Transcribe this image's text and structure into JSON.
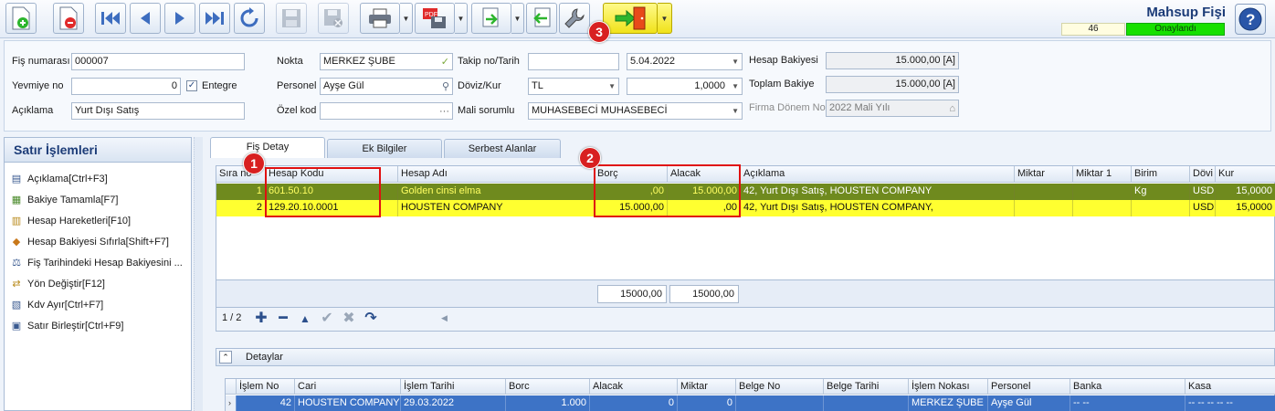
{
  "window": {
    "title": "Mahsup Fişi",
    "doc_count": "46",
    "status": "Onaylandı"
  },
  "toolbar": {
    "icons": [
      "new-icon",
      "delete-icon",
      "first-icon",
      "prev-icon",
      "next-icon",
      "last-icon",
      "refresh-icon",
      "save-icon",
      "cancel-save-icon",
      "print-icon",
      "pdf-icon",
      "export-icon",
      "import-icon",
      "settings-icon",
      "exit-icon"
    ],
    "markers": [
      "1",
      "2",
      "3"
    ]
  },
  "header": {
    "fis_no_label": "Fiş numarası",
    "fis_no_value": "000007",
    "yevmiye_label": "Yevmiye no",
    "yevmiye_value": "0",
    "entegre_label": "Entegre",
    "aciklama_label": "Açıklama",
    "aciklama_value": "Yurt Dışı Satış",
    "nokta_label": "Nokta",
    "nokta_value": "MERKEZ ŞUBE",
    "personel_label": "Personel",
    "personel_value": "Ayşe Gül",
    "ozel_kod_label": "Özel kod",
    "ozel_kod_value": "",
    "takip_label": "Takip no/Tarih",
    "takip_value": "",
    "tarih_value": "5.04.2022",
    "doviz_label": "Döviz/Kur",
    "doviz_value": "TL",
    "kur_value": "1,0000",
    "mali_label": "Mali sorumlu",
    "mali_value": "MUHASEBECİ MUHASEBECİ",
    "hesap_bakiyesi_label": "Hesap Bakiyesi",
    "hesap_bakiyesi_value": "15.000,00 [A]",
    "toplam_bakiye_label": "Toplam Bakiye",
    "toplam_bakiye_value": "15.000,00 [A]",
    "firma_donem_label": "Firma Dönem No",
    "firma_donem_value": "2022 Mali Yılı"
  },
  "left_panel": {
    "title": "Satır İşlemleri",
    "items": [
      {
        "label": "Açıklama[Ctrl+F3]",
        "icon": "description-icon"
      },
      {
        "label": "Bakiye Tamamla[F7]",
        "icon": "balance-icon"
      },
      {
        "label": "Hesap Hareketleri[F10]",
        "icon": "movements-icon"
      },
      {
        "label": "Hesap Bakiyesi Sıfırla[Shift+F7]",
        "icon": "reset-balance-icon"
      },
      {
        "label": "Fiş Tarihindeki Hesap Bakiyesini ...",
        "icon": "date-balance-icon"
      },
      {
        "label": "Yön Değiştir[F12]",
        "icon": "direction-icon"
      },
      {
        "label": "Kdv Ayır[Ctrl+F7]",
        "icon": "vat-icon"
      },
      {
        "label": "Satır Birleştir[Ctrl+F9]",
        "icon": "merge-icon"
      }
    ]
  },
  "tabs": [
    "Fiş Detay",
    "Ek Bilgiler",
    "Serbest Alanlar"
  ],
  "grid": {
    "columns": [
      "Sıra no",
      "Hesap Kodu",
      "Hesap Adı",
      "Borç",
      "Alacak",
      "Açıklama",
      "Miktar",
      "Miktar 1",
      "Birim",
      "Dövi",
      "Kur"
    ],
    "rows": [
      [
        "1",
        "601.50.10",
        "Golden cinsi elma",
        ",00",
        "15.000,00",
        "42, Yurt Dışı Satış, HOUSTEN COMPANY",
        "",
        "",
        "Kg",
        "USD",
        "15,0000"
      ],
      [
        "2",
        "129.20.10.0001",
        "HOUSTEN COMPANY",
        "15.000,00",
        ",00",
        "42, Yurt Dışı Satış, HOUSTEN COMPANY,",
        "",
        "",
        "",
        "USD",
        "15,0000"
      ]
    ],
    "total_borc": "15000,00",
    "total_alacak": "15000,00",
    "record_nav": "1 / 2"
  },
  "details": {
    "title": "Detaylar",
    "columns": [
      "İşlem No",
      "Cari",
      "İşlem Tarihi",
      "Borc",
      "Alacak",
      "Miktar",
      "Belge No",
      "Belge Tarihi",
      "İşlem Nokası",
      "Personel",
      "Banka",
      "Kasa"
    ],
    "row": [
      "42",
      "HOUSTEN COMPANY",
      "29.03.2022",
      "1.000",
      "0",
      "0",
      "",
      "",
      "MERKEZ ŞUBE",
      "Ayşe Gül",
      "-- --",
      "-- -- -- -- --"
    ]
  },
  "colors": {
    "row_selected": "#6f8a1e",
    "row_highlight": "#ffff30",
    "status_green": "#16e000",
    "marker_red": "#d82020"
  }
}
